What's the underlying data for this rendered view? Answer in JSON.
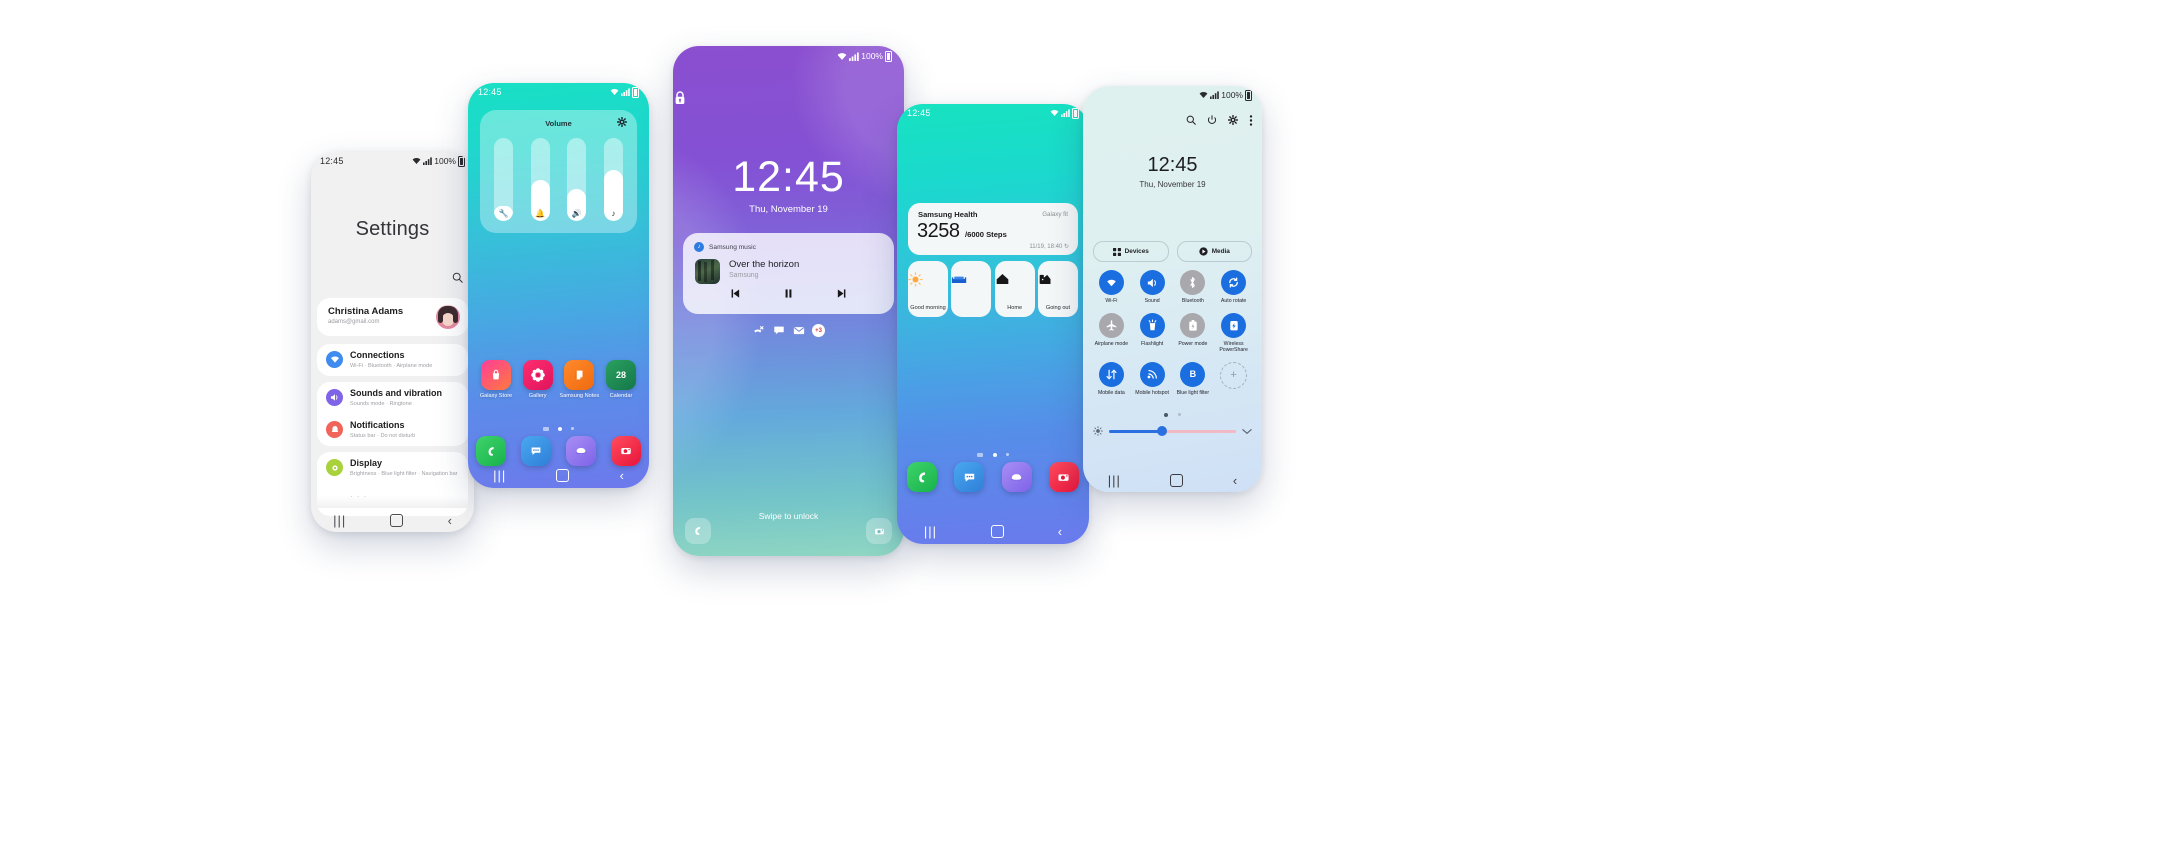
{
  "common": {
    "time": "12:45",
    "date": "Thu, November 19",
    "battery": "100%",
    "nav": {
      "recent": "|||",
      "home": "home-square",
      "back": "‹"
    }
  },
  "settings_phone": {
    "status_time": "12:45",
    "title": "Settings",
    "search_icon": "search-icon",
    "account": {
      "name": "Christina Adams",
      "email": "adams@gmail.com"
    },
    "rows": [
      {
        "title": "Connections",
        "subtitle": "Wi-Fi  ·  Bluetooth  ·  Airplane mode",
        "icon": "wifi-icon",
        "color": "#3f8bf0"
      },
      {
        "title": "Sounds and vibration",
        "subtitle": "Sounds mode  ·  Ringtone",
        "icon": "speaker-icon",
        "color": "#8064e8"
      },
      {
        "title": "Notifications",
        "subtitle": "Status bar  ·  Do not disturb",
        "icon": "bell-icon",
        "color": "#f0645a"
      },
      {
        "title": "Display",
        "subtitle": "Brightness  ·  Blue light filter  ·  Navigation bar",
        "icon": "display-icon",
        "color": "#a8d13a"
      }
    ],
    "more_indicator": "· · ·"
  },
  "volume_phone": {
    "status_time": "12:45",
    "panel_title": "Volume",
    "settings_icon": "gear-icon",
    "sliders": [
      {
        "name": "ringtone",
        "icon": "🔧",
        "level": 18
      },
      {
        "name": "notification",
        "icon": "🔔",
        "level": 50
      },
      {
        "name": "media",
        "icon": "🔊",
        "level": 38
      },
      {
        "name": "system",
        "icon": "♪",
        "level": 62
      }
    ],
    "apps": [
      {
        "label": "Galaxy Store",
        "icon": "🛍",
        "color": "linear-gradient(140deg,#ff3d9a,#ff7a3d)"
      },
      {
        "label": "Gallery",
        "icon": "✿",
        "color": "linear-gradient(140deg,#ff2d6f,#e0145c)"
      },
      {
        "label": "Samsung Notes",
        "icon": "✎",
        "color": "linear-gradient(140deg,#ff8a2b,#f06a10)"
      },
      {
        "label": "Calendar",
        "icon": "28",
        "color": "linear-gradient(140deg,#2aa05f,#14774a)"
      }
    ],
    "page_dots": {
      "count": 3,
      "active": 1
    },
    "dock": [
      {
        "name": "phone",
        "icon": "✆",
        "color": "linear-gradient(140deg,#3fd36b,#17b24b)"
      },
      {
        "name": "messages",
        "icon": "●●●",
        "color": "linear-gradient(140deg,#4aa8f0,#2e7fd8)"
      },
      {
        "name": "internet",
        "icon": "◖",
        "color": "linear-gradient(140deg,#a98ef5,#7d63e8)"
      },
      {
        "name": "camera",
        "icon": "◉",
        "color": "linear-gradient(140deg,#ff4d5e,#e8143a)"
      }
    ]
  },
  "lock_phone": {
    "battery": "100%",
    "lock_icon": "lock-icon",
    "time": "12:45",
    "date": "Thu, November 19",
    "music": {
      "app": "Samsung music",
      "title": "Over the horizon",
      "artist": "Samsung",
      "controls": [
        "previous",
        "pause",
        "next"
      ],
      "prev_glyph": "⏮",
      "pause_glyph": "⏸",
      "next_glyph": "⏭"
    },
    "notification_icons": [
      "missed-call-icon",
      "message-icon",
      "email-icon"
    ],
    "notification_more": "+3",
    "swipe_text": "Swipe to unlock",
    "shortcut_left": "phone-shortcut",
    "shortcut_right": "camera-shortcut"
  },
  "health_phone": {
    "status_time": "12:45",
    "widget": {
      "app": "Samsung Health",
      "device": "Galaxy fit",
      "steps": "3258",
      "goal": "/6000 Steps",
      "updated": "11/19, 18:40",
      "refresh_icon": "refresh-icon"
    },
    "routines": [
      {
        "label": "Good morning",
        "icon": "☀"
      },
      {
        "label": "",
        "icon": "🛹"
      },
      {
        "label": "Home",
        "icon": "⌂"
      },
      {
        "label": "Going out",
        "icon": "🚪"
      }
    ],
    "page_dots": {
      "count": 3,
      "active": 1
    },
    "dock": [
      {
        "name": "phone",
        "icon": "✆",
        "color": "linear-gradient(140deg,#3fd36b,#17b24b)"
      },
      {
        "name": "messages",
        "icon": "●●●",
        "color": "linear-gradient(140deg,#4aa8f0,#2e7fd8)"
      },
      {
        "name": "internet",
        "icon": "◖",
        "color": "linear-gradient(140deg,#a98ef5,#7d63e8)"
      },
      {
        "name": "camera",
        "icon": "◉",
        "color": "linear-gradient(140deg,#ff4d5e,#e8143a)"
      }
    ]
  },
  "quickpanel_phone": {
    "battery": "100%",
    "header_icons": [
      "search-icon",
      "power-icon",
      "gear-icon",
      "more-icon"
    ],
    "time": "12:45",
    "date": "Thu, November 19",
    "pills": [
      {
        "label": "Devices",
        "icon": "devices-icon"
      },
      {
        "label": "Media",
        "icon": "media-play-icon"
      }
    ],
    "toggles": [
      {
        "label": "Wi-Fi",
        "on": true,
        "icon": "wifi-icon"
      },
      {
        "label": "Sound",
        "on": true,
        "icon": "sound-icon"
      },
      {
        "label": "Bluetooth",
        "on": false,
        "icon": "bluetooth-icon"
      },
      {
        "label": "Auto rotate",
        "on": true,
        "icon": "autorotate-icon"
      },
      {
        "label": "Airplane mode",
        "on": false,
        "icon": "airplane-icon"
      },
      {
        "label": "Flashlight",
        "on": true,
        "icon": "flashlight-icon"
      },
      {
        "label": "Power mode",
        "on": false,
        "icon": "powermode-icon"
      },
      {
        "label": "Wireless PowerShare",
        "on": true,
        "icon": "powershare-icon"
      },
      {
        "label": "Mobile data",
        "on": true,
        "icon": "mobiledata-icon"
      },
      {
        "label": "Mobile hotspot",
        "on": true,
        "icon": "hotspot-icon"
      },
      {
        "label": "Blue light filter",
        "on": true,
        "icon": "bluelight-icon"
      }
    ],
    "add_button": "+",
    "page_dots": {
      "count": 2,
      "active": 0
    },
    "brightness": {
      "value": 42,
      "left_icon": "brightness-icon",
      "right_icon": "chevron-down-icon"
    },
    "colors": {
      "on": "#1a6ee0",
      "off": "#a8a8ad"
    }
  }
}
